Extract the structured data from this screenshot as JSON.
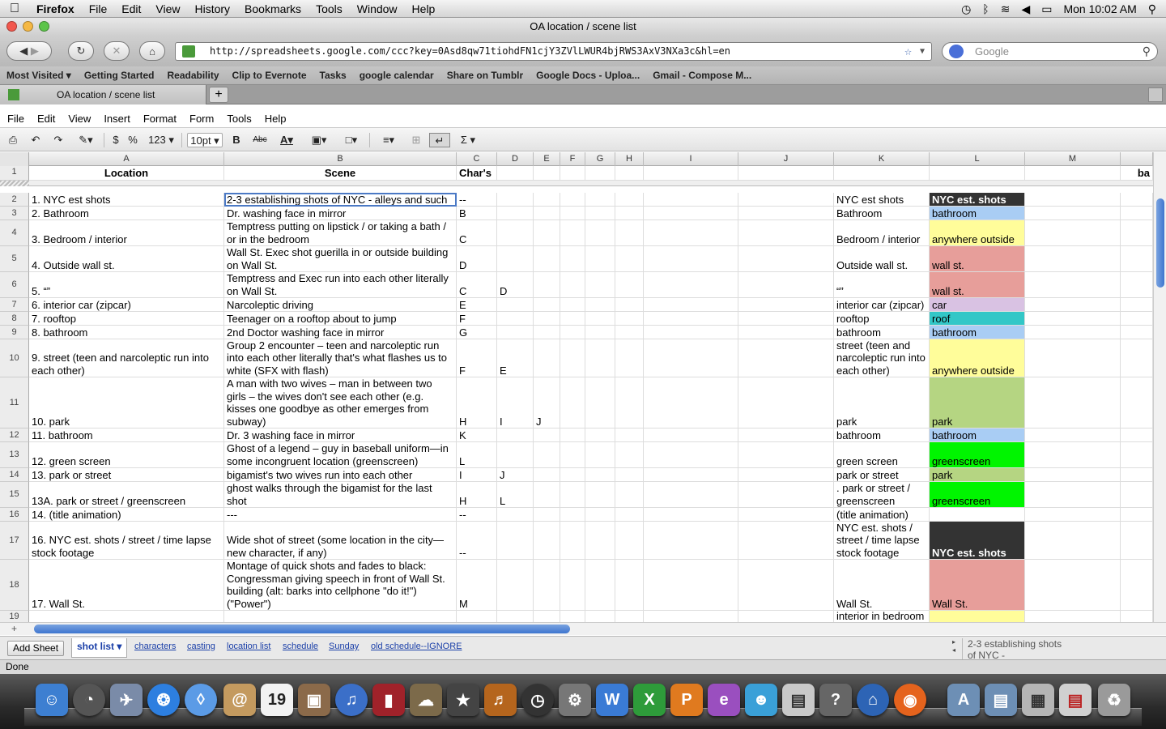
{
  "menubar": {
    "app": "Firefox",
    "items": [
      "File",
      "Edit",
      "View",
      "History",
      "Bookmarks",
      "Tools",
      "Window",
      "Help"
    ],
    "clock": "Mon 10:02 AM"
  },
  "window": {
    "title": "OA location / scene list",
    "url": "http://spreadsheets.google.com/ccc?key=0Asd8qw71tiohdFN1cjY3ZVlLWUR4bjRWS3AxV3NXa3c&hl=en",
    "search_placeholder": "Google"
  },
  "bookmarks": [
    "Most Visited ▾",
    "Getting Started",
    "Readability",
    "Clip to Evernote",
    "Tasks",
    "google calendar",
    "Share on Tumblr",
    "Google Docs - Uploa...",
    "Gmail - Compose M..."
  ],
  "tab": {
    "label": "OA location / scene list"
  },
  "app_menu": [
    "File",
    "Edit",
    "View",
    "Insert",
    "Format",
    "Form",
    "Tools",
    "Help"
  ],
  "toolbar": {
    "currency": "$",
    "percent": "%",
    "number_format": "123 ▾",
    "font_size": "10pt ▾",
    "bold": "B",
    "strike": "Abc",
    "text_color": "A",
    "sum": "Σ ▾"
  },
  "columns": [
    "A",
    "B",
    "C",
    "D",
    "E",
    "F",
    "G",
    "H",
    "I",
    "J",
    "K",
    "L",
    "M"
  ],
  "header_row": {
    "num": "1",
    "a": "Location",
    "b": "Scene",
    "c": "Char's",
    "n": "ba"
  },
  "rows": [
    {
      "num": "2",
      "a": "1. NYC est shots",
      "b": "2-3 establishing shots of NYC - alleys and such",
      "c": "--",
      "d": "",
      "e": "",
      "k": "NYC est shots",
      "l": "NYC est. shots",
      "l_bg": "#333333",
      "l_fg": "#ffffff",
      "l_bold": true
    },
    {
      "num": "3",
      "a": "2. Bathroom",
      "b": "Dr. washing face in mirror",
      "c": "B",
      "d": "",
      "e": "",
      "k": "Bathroom",
      "l": "bathroom",
      "l_bg": "#a9cdf4",
      "l_fg": "#000000"
    },
    {
      "num": "4",
      "a": "3. Bedroom / interior",
      "b": "Temptress putting on lipstick / or taking a bath / or in the bedroom",
      "c": "C",
      "d": "",
      "e": "",
      "k": "Bedroom / interior",
      "l": "anywhere outside",
      "l_bg": "#fffd9a",
      "l_fg": "#000000"
    },
    {
      "num": "5",
      "a": "4. Outside wall st.",
      "b": "Wall St. Exec shot guerilla in or outside building on Wall St.",
      "c": "D",
      "d": "",
      "e": "",
      "k": "Outside wall st.",
      "l": "wall st.",
      "l_bg": "#e79e9a",
      "l_fg": "#000000"
    },
    {
      "num": "6",
      "a": "5. “”",
      "b": "Temptress and Exec run into each other literally on Wall St.",
      "c": "C",
      "d": "D",
      "e": "",
      "k": "“”",
      "l": "wall st.",
      "l_bg": "#e79e9a",
      "l_fg": "#000000"
    },
    {
      "num": "7",
      "a": "6. interior car (zipcar)",
      "b": "Narcoleptic driving",
      "c": "E",
      "d": "",
      "e": "",
      "k": "interior car (zipcar)",
      "l": "car",
      "l_bg": "#d9c2e3",
      "l_fg": "#000000"
    },
    {
      "num": "8",
      "a": "7. rooftop",
      "b": "Teenager on a rooftop about to jump",
      "c": "F",
      "d": "",
      "e": "",
      "k": "rooftop",
      "l": "roof",
      "l_bg": "#33c7c7",
      "l_fg": "#000000"
    },
    {
      "num": "9",
      "a": "8. bathroom",
      "b": "2nd Doctor washing face in mirror",
      "c": "G",
      "d": "",
      "e": "",
      "k": "bathroom",
      "l": "bathroom",
      "l_bg": "#a9cdf4",
      "l_fg": "#000000"
    },
    {
      "num": "10",
      "a": "9. street (teen and narcoleptic run into each other)",
      "b": "Group 2 encounter – teen and narcoleptic run into each other literally that's what flashes us to white (SFX with flash)",
      "c": "F",
      "d": "E",
      "e": "",
      "k": "street (teen and narcoleptic run into each other)",
      "l": "anywhere outside",
      "l_bg": "#fffd9a",
      "l_fg": "#000000"
    },
    {
      "num": "11",
      "a": "10. park",
      "b": "A man with two wives – man in between two girls – the wives don't see each other (e.g. kisses one goodbye as other emerges from subway)",
      "c": "H",
      "d": "I",
      "e": "J",
      "k": "park",
      "l": "park",
      "l_bg": "#b5d582",
      "l_fg": "#000000"
    },
    {
      "num": "12",
      "a": "11. bathroom",
      "b": "Dr. 3 washing face in mirror",
      "c": "K",
      "d": "",
      "e": "",
      "k": "bathroom",
      "l": "bathroom",
      "l_bg": "#a9cdf4",
      "l_fg": "#000000"
    },
    {
      "num": "13",
      "a": "12. green screen",
      "b": "Ghost of a legend – guy in baseball uniform—in some incongruent location (greenscreen)",
      "c": "L",
      "d": "",
      "e": "",
      "k": "green screen",
      "l": "greenscreen",
      "l_bg": "#00f500",
      "l_fg": "#000000"
    },
    {
      "num": "14",
      "a": "13. park or street",
      "b": "bigamist's two wives run into each other",
      "c": "I",
      "d": "J",
      "e": "",
      "k": "park or street",
      "l": "park",
      "l_bg": "#b5d582",
      "l_fg": "#000000"
    },
    {
      "num": "15",
      "a": "13A. park or street / greenscreen",
      "b": "ghost walks through the bigamist for the last shot",
      "c": "H",
      "d": "L",
      "e": "",
      "k": ". park or street / greenscreen",
      "l": "greenscreen",
      "l_bg": "#00f500",
      "l_fg": "#000000"
    },
    {
      "num": "16",
      "a": "14. (title animation)",
      "b": "---",
      "c": "--",
      "d": "",
      "e": "",
      "k": "(title animation)",
      "l": "",
      "l_bg": "#ffffff",
      "l_fg": "#000000"
    },
    {
      "num": "17",
      "a": "16. NYC est. shots / street / time lapse stock footage",
      "b": "Wide shot of street (some location in the city—new character, if any)",
      "c": "--",
      "d": "",
      "e": "",
      "k": "NYC est. shots / street / time lapse stock footage",
      "l": "NYC est. shots",
      "l_bg": "#333333",
      "l_fg": "#ffffff",
      "l_bold": true
    },
    {
      "num": "18",
      "a": "17. Wall St.",
      "b": "Montage of quick shots and fades to black: Congressman giving speech in front of Wall St. building (alt: barks into cellphone \"do it!\") (\"Power\")",
      "c": "M",
      "d": "",
      "e": "",
      "k": "Wall St.",
      "l": "Wall St.",
      "l_bg": "#e79e9a",
      "l_fg": "#000000"
    },
    {
      "num": "19",
      "a": "",
      "b": "",
      "c": "",
      "d": "",
      "e": "",
      "k": "interior in bedroom",
      "l": "",
      "l_bg": "#fffd9a",
      "l_fg": "#000000"
    }
  ],
  "sheets": {
    "add_label": "Add Sheet",
    "tabs": [
      "shot list ▾",
      "characters",
      "casting",
      "location list",
      "schedule",
      "Sunday",
      "old schedule--IGNORE"
    ],
    "preview": "2-3 establishing shots of NYC -"
  },
  "status": "Done"
}
